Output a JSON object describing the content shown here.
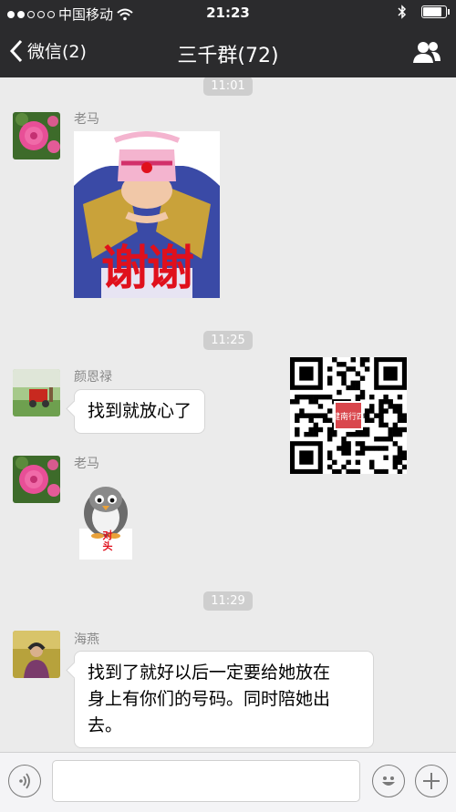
{
  "status_bar": {
    "carrier": "中国移动",
    "time": "21:23",
    "battery_level": 0.9
  },
  "nav": {
    "back_label": "微信(2)",
    "title": "三千群(72)"
  },
  "messages": [
    {
      "timestamp": "11:01"
    },
    {
      "sender": "老马",
      "sticker_text": "谢谢"
    },
    {
      "timestamp": "11:25"
    },
    {
      "sender": "颜恩禄",
      "text": "找到就放心了"
    },
    {
      "sender": "老马",
      "sticker_text": "对头"
    },
    {
      "timestamp": "11:29"
    },
    {
      "sender": "海燕",
      "text_lines": [
        "找到了就好以后一定要给她放在",
        "身上有你们的号码。同时陪她出",
        "去。"
      ]
    }
  ],
  "overlay": {
    "qr_seal_text": "健南行四"
  },
  "input": {
    "placeholder": ""
  },
  "colors": {
    "nav_bg": "#2b2b2d",
    "chat_bg": "#ebebeb",
    "timestamp_bg": "#cecece",
    "sticker_red": "#e0101c"
  },
  "icons": [
    "wifi-icon",
    "bluetooth-icon",
    "battery-icon",
    "back-chevron-icon",
    "group-members-icon",
    "voice-icon",
    "emoji-icon",
    "plus-icon"
  ]
}
